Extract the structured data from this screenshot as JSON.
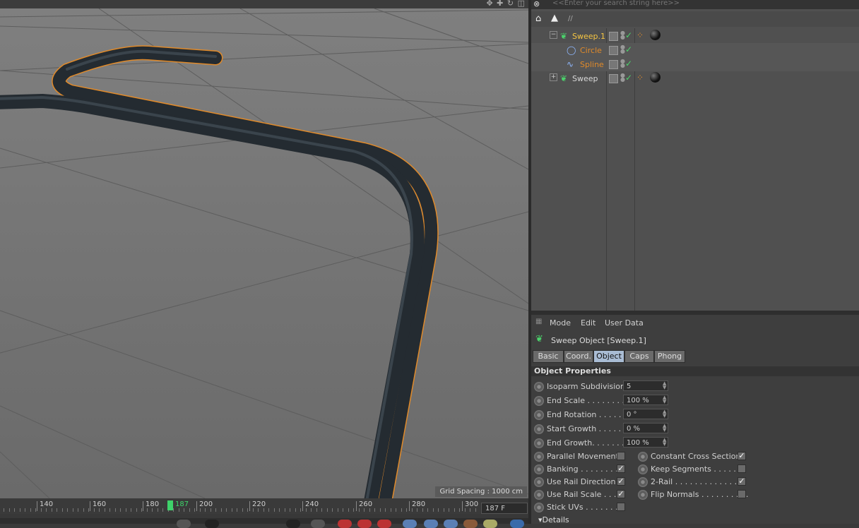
{
  "viewport": {
    "grid_spacing": "Grid Spacing : 1000 cm",
    "top_icons": "✥ ✚ ↻ ◫"
  },
  "object_manager": {
    "search_placeholder": "<<Enter your search string here>>",
    "path": "//",
    "objects": [
      {
        "name": "Sweep.1",
        "color": "#f5c542",
        "icon": "sweep-icon",
        "level": 0
      },
      {
        "name": "Circle",
        "color": "#e08a2a",
        "icon": "circle-spline-icon",
        "level": 1
      },
      {
        "name": "Spline",
        "color": "#e08a2a",
        "icon": "spline-icon",
        "level": 1
      },
      {
        "name": "Sweep",
        "color": "#d8d8d8",
        "icon": "sweep-icon",
        "level": 0
      }
    ]
  },
  "attribute_manager": {
    "menu": [
      "Mode",
      "Edit",
      "User Data"
    ],
    "title": "Sweep Object [Sweep.1]",
    "tabs": [
      "Basic",
      "Coord.",
      "Object",
      "Caps",
      "Phong"
    ],
    "active_tab": "Object",
    "section": "Object Properties",
    "fields": [
      {
        "label": "Isoparm Subdivision",
        "value": "5"
      },
      {
        "label": "End Scale . . . . . . . . .",
        "value": "100 %"
      },
      {
        "label": "End Rotation . . . . . .",
        "value": "0 °"
      },
      {
        "label": "Start Growth . . . . . .",
        "value": "0 %"
      },
      {
        "label": "End Growth. . . . . . .",
        "value": "100 %"
      }
    ],
    "checks_left": [
      {
        "label": "Parallel Movement",
        "checked": false
      },
      {
        "label": "Banking . . . . . . . . .",
        "checked": true
      },
      {
        "label": "Use Rail Direction",
        "checked": true
      },
      {
        "label": "Use Rail Scale . . .",
        "checked": true
      },
      {
        "label": "Stick UVs . . . . . . .",
        "checked": false
      }
    ],
    "checks_right": [
      {
        "label": "Constant Cross Section",
        "checked": true
      },
      {
        "label": "Keep Segments . . . . . . .",
        "checked": false
      },
      {
        "label": "2-Rail . . . . . . . . . . . . . . .",
        "checked": true
      },
      {
        "label": "Flip Normals . . . . . . . . . .",
        "checked": false
      }
    ],
    "details": "▾Details"
  },
  "timeline": {
    "ticks": [
      "140",
      "160",
      "180",
      "200",
      "220",
      "240",
      "260",
      "280",
      "300"
    ],
    "current_frame": "187",
    "frame_field": "187 F"
  },
  "colors": {
    "selection_outline": "#e08a2a",
    "tube": "#2a3138",
    "playhead": "#3ed26a"
  }
}
